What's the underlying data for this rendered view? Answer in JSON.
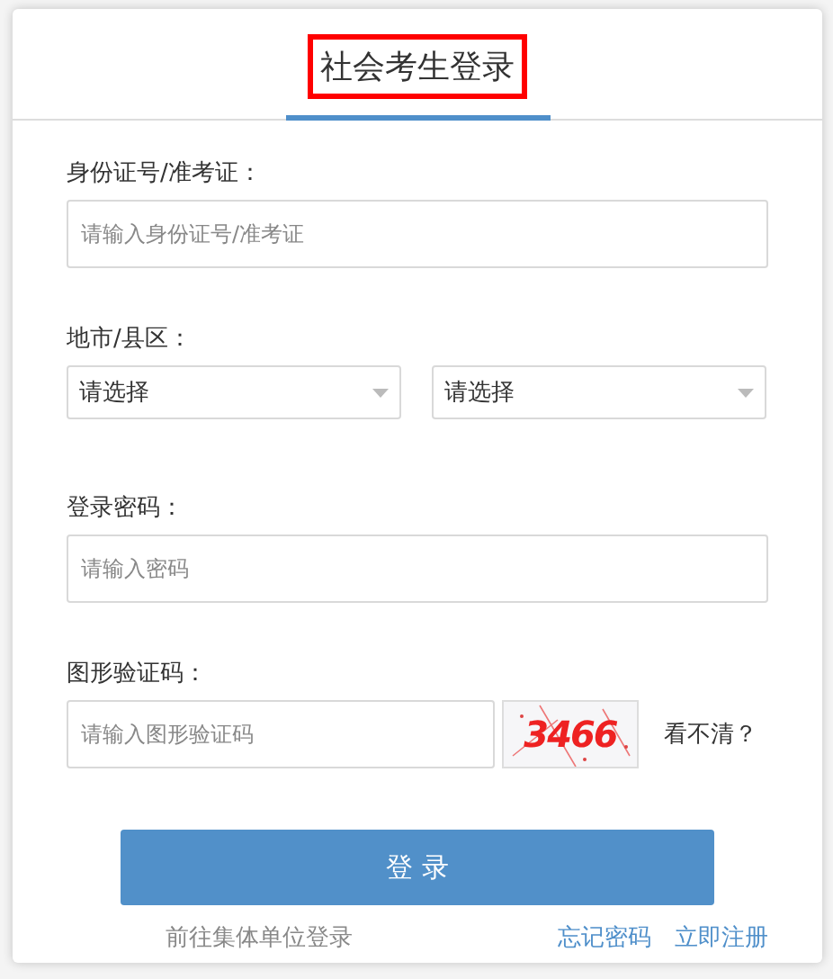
{
  "tabs": [
    {
      "label": "社会考生登录",
      "selected": true,
      "highlighted": true
    }
  ],
  "fields": [
    {
      "kind": "text",
      "label": "身份证号/准考证：",
      "placeholder": "请输入身份证号/准考证"
    },
    {
      "kind": "selects",
      "label": "地市/县区：",
      "selects": [
        "请选择",
        "请选择"
      ]
    },
    {
      "kind": "password",
      "label": "登录密码：",
      "placeholder": "请输入密码"
    },
    {
      "kind": "captcha",
      "label": "图形验证码：",
      "placeholder": "请输入图形验证码",
      "code": "3466",
      "refresh": "看不清？"
    }
  ],
  "login_button": "登 录",
  "links": {
    "left": "前往集体单位登录",
    "right": [
      "忘记密码",
      "立即注册"
    ]
  }
}
